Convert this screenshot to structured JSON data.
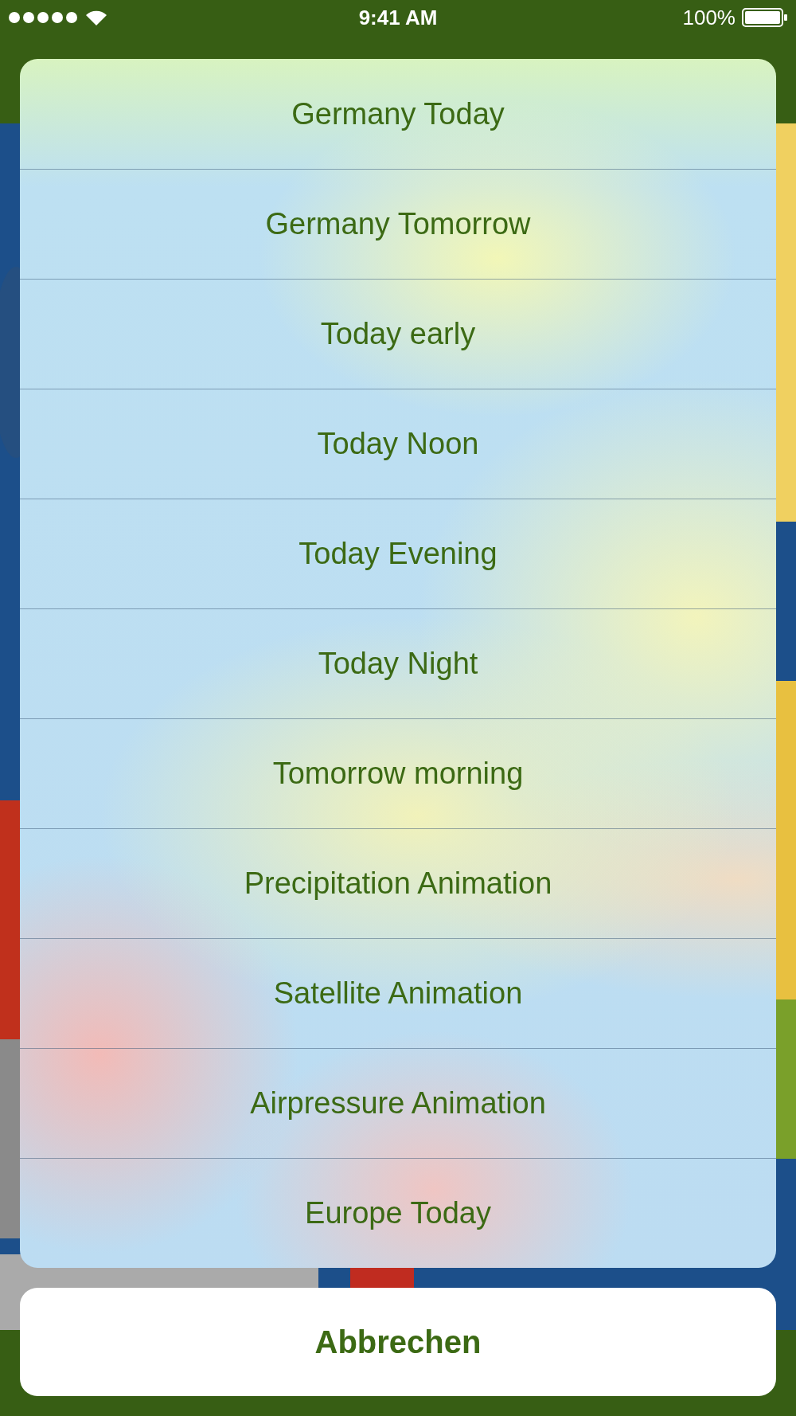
{
  "status_bar": {
    "time": "9:41 AM",
    "battery": "100%"
  },
  "action_sheet": {
    "options": [
      {
        "label": "Germany Today"
      },
      {
        "label": "Germany Tomorrow"
      },
      {
        "label": "Today early"
      },
      {
        "label": "Today Noon"
      },
      {
        "label": "Today Evening"
      },
      {
        "label": "Today Night"
      },
      {
        "label": "Tomorrow morning"
      },
      {
        "label": "Precipitation Animation"
      },
      {
        "label": "Satellite Animation"
      },
      {
        "label": "Airpressure Animation"
      },
      {
        "label": "Europe Today"
      }
    ],
    "cancel": "Abbrechen"
  }
}
